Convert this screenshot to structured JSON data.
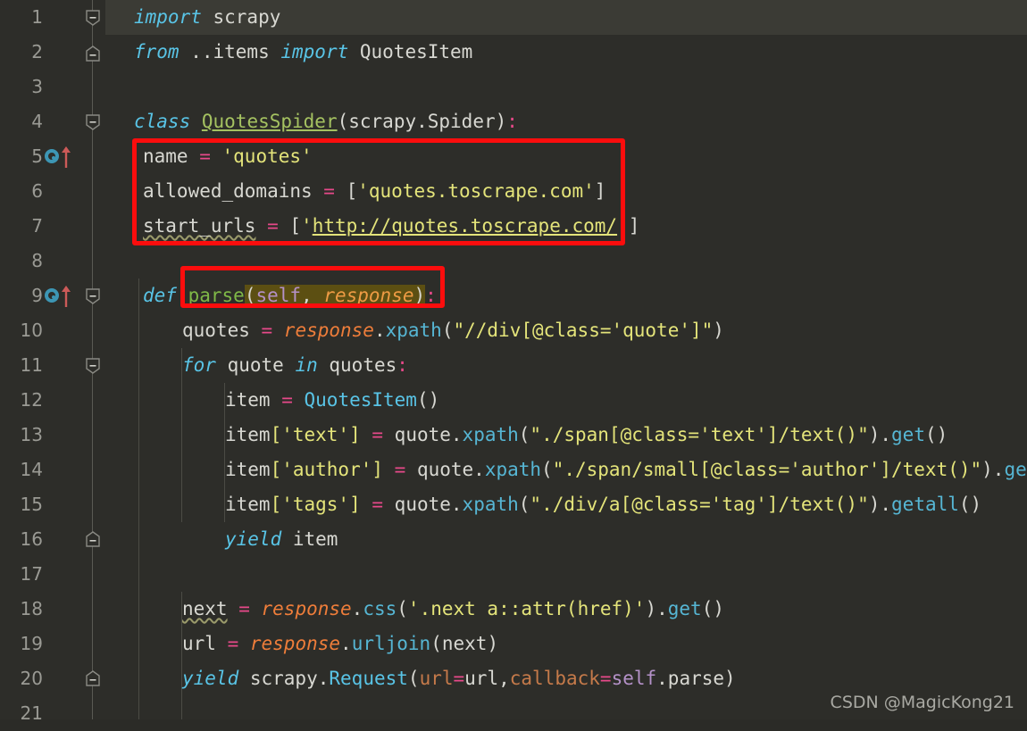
{
  "editor": {
    "theme_background": "#2d2d29",
    "caret_line_background": "#3b3b35",
    "gutter_text_color": "#9a9a94",
    "annotation_color": "#fb0d0d",
    "first_visible_line": 1,
    "last_visible_line": 21
  },
  "line_numbers": [
    "1",
    "2",
    "3",
    "4",
    "5",
    "6",
    "7",
    "8",
    "9",
    "10",
    "11",
    "12",
    "13",
    "14",
    "15",
    "16",
    "17",
    "18",
    "19",
    "20",
    "21"
  ],
  "gutter_markers": [
    {
      "line": 5,
      "icons": [
        "override-circle-icon",
        "up-arrow-icon"
      ]
    },
    {
      "line": 9,
      "icons": [
        "override-circle-icon",
        "up-arrow-icon"
      ]
    }
  ],
  "fold_markers": [
    {
      "line": 1,
      "type": "fold-minus-icon"
    },
    {
      "line": 2,
      "type": "fold-end-icon"
    },
    {
      "line": 4,
      "type": "fold-minus-icon"
    },
    {
      "line": 9,
      "type": "fold-minus-icon"
    },
    {
      "line": 11,
      "type": "fold-minus-icon"
    },
    {
      "line": 16,
      "type": "fold-end-icon"
    },
    {
      "line": 20,
      "type": "fold-end-icon"
    }
  ],
  "code": {
    "l1": {
      "kw": "import",
      "rest": " scrapy"
    },
    "l2": {
      "kw": "from",
      "mod": " ..items ",
      "kw2": "import",
      "name": " QuotesItem"
    },
    "l3": {
      "text": ""
    },
    "l4": {
      "kw": "class",
      "name": "QuotesSpider",
      "paren_open": "(",
      "base": "scrapy.Spider",
      "paren_close": ")",
      "colon": ":"
    },
    "l5": {
      "var": "name",
      "op": " = ",
      "value": "'quotes'"
    },
    "l6": {
      "var": "allowed_domains",
      "op": " = ",
      "bracket_open": "[",
      "value": "'quotes.toscrape.com'",
      "bracket_close": "]"
    },
    "l7": {
      "var": "start_urls",
      "op": " = ",
      "bracket_open": "[",
      "quote": "'",
      "url": "http://quotes.toscrape.com/",
      "quote2": "'",
      "bracket_close": "]"
    },
    "l8": {
      "text": ""
    },
    "l9": {
      "kw": "def",
      "fn": "parse",
      "paren_open": "(",
      "self": "self",
      "comma": ", ",
      "param": "response",
      "paren_close": ")",
      "colon": ":"
    },
    "l10": {
      "var": "quotes",
      "op": " = ",
      "obj": "response",
      "dot": ".",
      "meth": "xpath",
      "paren_open": "(",
      "arg": "\"//div[@class='quote']\"",
      "paren_close": ")"
    },
    "l11": {
      "kw": "for",
      "var": " quote ",
      "kw2": "in",
      "iter": " quotes",
      "colon": ":"
    },
    "l12": {
      "var": "item",
      "op": " = ",
      "cls": "QuotesItem",
      "parens": "()"
    },
    "l13": {
      "var": "item",
      "key": "['text']",
      "op": " = ",
      "obj": "quote",
      "dot": ".",
      "meth": "xpath",
      "paren_open": "(",
      "arg": "\"./span[@class='text']/text()\"",
      "paren_close": ")",
      "dot2": ".",
      "meth2": "get",
      "parens2": "()"
    },
    "l14": {
      "var": "item",
      "key": "['author']",
      "op": " = ",
      "obj": "quote",
      "dot": ".",
      "meth": "xpath",
      "paren_open": "(",
      "arg": "\"./span/small[@class='author']/text()\"",
      "paren_close": ")",
      "dot2": ".",
      "meth2": "get",
      "parens2": "()"
    },
    "l15": {
      "var": "item",
      "key": "['tags']",
      "op": " = ",
      "obj": "quote",
      "dot": ".",
      "meth": "xpath",
      "paren_open": "(",
      "arg": "\"./div/a[@class='tag']/text()\"",
      "paren_close": ")",
      "dot2": ".",
      "meth2": "getall",
      "parens2": "()"
    },
    "l16": {
      "kw": "yield",
      "rest": " item"
    },
    "l17": {
      "text": ""
    },
    "l18": {
      "var": "next",
      "op": " = ",
      "obj": "response",
      "dot": ".",
      "meth": "css",
      "paren_open": "(",
      "arg": "'.next a::attr(href)'",
      "paren_close": ")",
      "dot2": ".",
      "meth2": "get",
      "parens2": "()"
    },
    "l19": {
      "var": "url",
      "op": " = ",
      "obj": "response",
      "dot": ".",
      "meth": "urljoin",
      "paren_open": "(",
      "arg": "next",
      "paren_close": ")"
    },
    "l20": {
      "kw": "yield",
      "mod": " scrapy",
      "dot": ".",
      "cls": "Request",
      "paren_open": "(",
      "kwarg1": "url",
      "eq1": "=",
      "val1": "url",
      "comma": ",",
      "kwarg2": "callback",
      "eq2": "=",
      "self": "self",
      "dot2": ".",
      "val2": "parse",
      "paren_close": ")"
    },
    "l21": {
      "text": ""
    }
  },
  "annotations": [
    {
      "name": "class-attributes-highlight",
      "targets_lines": [
        5,
        6,
        7
      ]
    },
    {
      "name": "parse-signature-highlight",
      "targets_lines": [
        9
      ]
    }
  ],
  "watermark": {
    "text": "CSDN @MagicKong21"
  }
}
